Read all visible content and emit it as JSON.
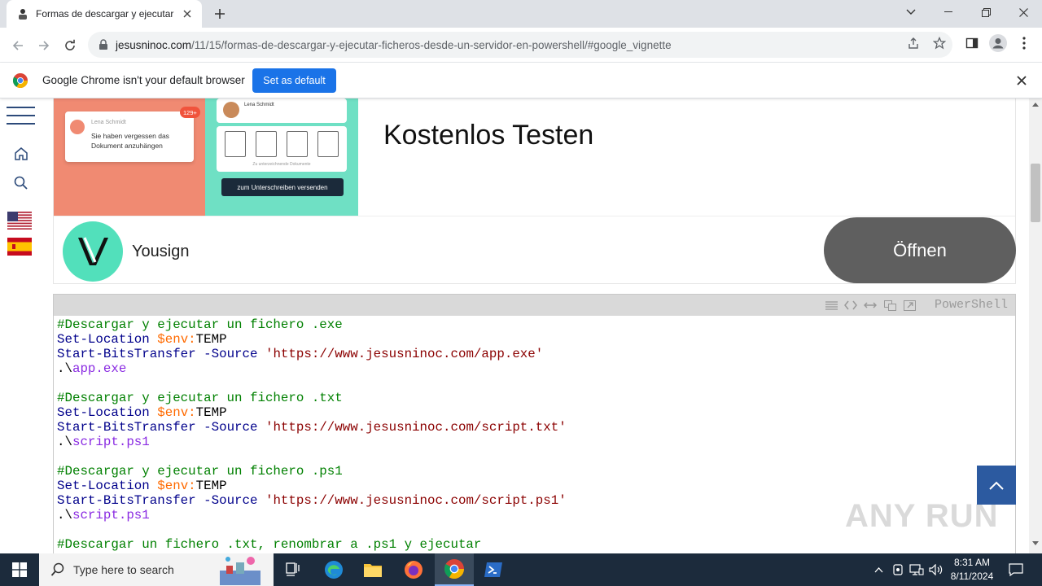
{
  "browser": {
    "tab_title": "Formas de descargar y ejecutar f",
    "url_domain": "jesusninoc.com",
    "url_path": "/11/15/formas-de-descargar-y-ejecutar-ficheros-desde-un-servidor-en-powershell/#google_vignette"
  },
  "infobar": {
    "message": "Google Chrome isn't your default browser",
    "set_default_label": "Set as default"
  },
  "ad": {
    "mail_sender": "Lena Schmidt",
    "mail_text": "Sie haben vergessen das Dokument anzuhängen",
    "badge": "129+",
    "doc_person": "Lena Schmidt",
    "docs_caption": "Zu unterzeichnende Dokumente",
    "sign_button": "zum Unterschreiben versenden",
    "headline": "Kostenlos Testen",
    "brand": "Yousign",
    "open_label": "Öffnen",
    "brand_color": "#52e0bb"
  },
  "codeblock": {
    "language": "PowerShell",
    "sections": [
      {
        "comment": "#Descargar y ejecutar un fichero .exe",
        "cmd1": "Set-Location",
        "var": "$env:",
        "var_rest": "TEMP",
        "cmd2": "Start-BitsTransfer",
        "param": "-Source",
        "url": "'https://www.jesusninoc.com/app.exe'",
        "run_prefix": ".\\",
        "run": "app.exe"
      },
      {
        "comment": "#Descargar y ejecutar un fichero .txt",
        "cmd1": "Set-Location",
        "var": "$env:",
        "var_rest": "TEMP",
        "cmd2": "Start-BitsTransfer",
        "param": "-Source",
        "url": "'https://www.jesusninoc.com/script.txt'",
        "run_prefix": ".\\",
        "run": "script.ps1"
      },
      {
        "comment": "#Descargar y ejecutar un fichero .ps1",
        "cmd1": "Set-Location",
        "var": "$env:",
        "var_rest": "TEMP",
        "cmd2": "Start-BitsTransfer",
        "param": "-Source",
        "url": "'https://www.jesusninoc.com/script.ps1'",
        "run_prefix": ".\\",
        "run": "script.ps1"
      }
    ],
    "last_comment": "#Descargar un fichero .txt, renombrar a .ps1 y ejecutar"
  },
  "watermark": "ANY RUN",
  "taskbar": {
    "search_placeholder": "Type here to search",
    "time": "8:31 AM",
    "date": "8/11/2024"
  },
  "icons": [
    "tab-favicon",
    "close-icon",
    "plus-icon",
    "chevron-down-icon",
    "minimize-icon",
    "maximize-icon",
    "back-icon",
    "forward-icon",
    "reload-icon",
    "lock-icon",
    "share-icon",
    "star-icon",
    "sidepanel-icon",
    "profile-icon",
    "kebab-icon",
    "chrome-logo",
    "home-icon",
    "search-icon",
    "us-flag-icon",
    "es-flag-icon",
    "arrow-up-icon",
    "windows-icon"
  ]
}
